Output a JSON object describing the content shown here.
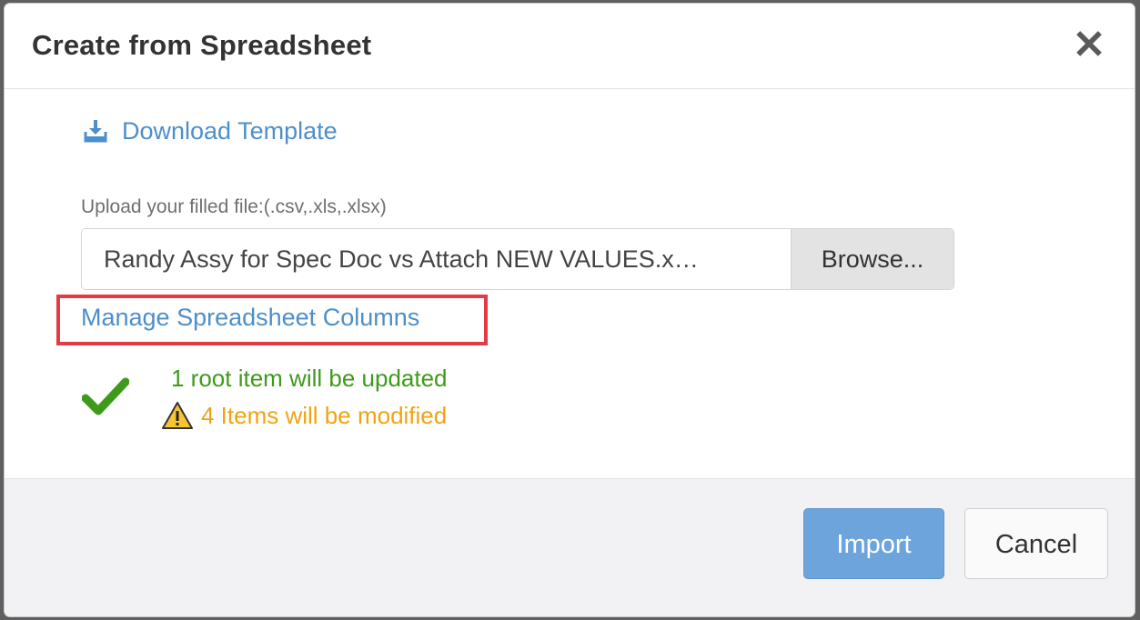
{
  "dialog": {
    "title": "Create from Spreadsheet",
    "close_symbol": "✕",
    "download_template_label": "Download Template",
    "upload_label": "Upload your filled file:(.csv,.xls,.xlsx)",
    "file_name": "Randy Assy for Spec Doc vs Attach NEW VALUES.x…",
    "browse_label": "Browse...",
    "manage_columns_label": "Manage Spreadsheet Columns",
    "status_success": "1 root item will be updated",
    "status_warning": "4 Items will be modified",
    "import_label": "Import",
    "cancel_label": "Cancel"
  },
  "icons": {
    "download": "download-icon",
    "check": "checkmark-icon",
    "warning": "warning-icon",
    "close": "close-icon"
  },
  "colors": {
    "link": "#4d8fca",
    "success": "#3f9a1b",
    "warning": "#f0a314",
    "highlight": "#e23b45",
    "primary_button": "#6ea4dc"
  }
}
